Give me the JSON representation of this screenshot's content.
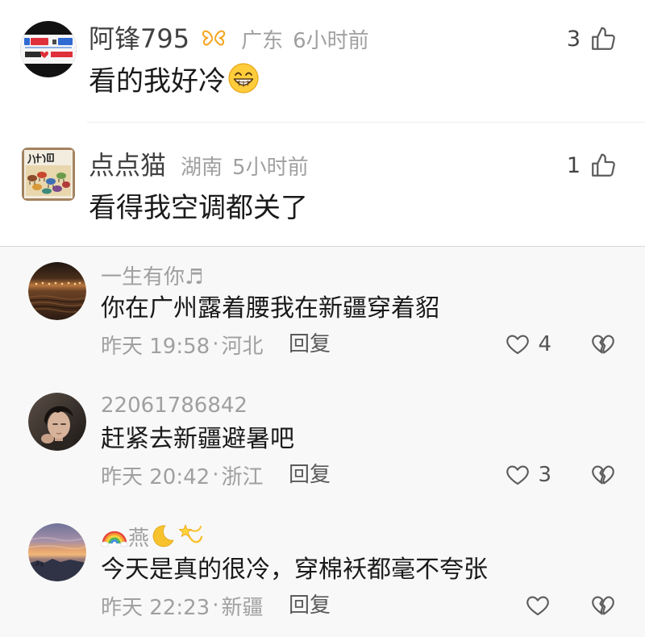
{
  "colors": {
    "text": "#1a1a1a",
    "username-top": "#414141",
    "muted": "#a0a0a0",
    "reply": "#5a5a5a",
    "icon": "#5c5c5c",
    "badge": "#f5a623",
    "section-bg": "#f8f8f8"
  },
  "icons": {
    "like": "thumbs-up-icon",
    "heart": "heart-outline-icon",
    "dislike": "broken-heart-icon"
  },
  "meta_separator": "·",
  "reply_label": "回复",
  "top_comments": [
    {
      "username": "阿锋795",
      "badge_icon": "butterfly-badge-icon",
      "location": "广东",
      "time": "6小时前",
      "likes": "3",
      "text": "看的我好冷",
      "text_emoji": "beaming-face-emoji"
    },
    {
      "username": "点点猫",
      "location": "湖南",
      "time": "5小时前",
      "likes": "1",
      "text": "看得我空调都关了"
    }
  ],
  "bottom_comments": [
    {
      "username": "一生有你♬",
      "text": "你在广州露着腰我在新疆穿着貂",
      "time": "昨天 19:58",
      "location": "河北",
      "likes": "4"
    },
    {
      "username": "22061786842",
      "text": "赶紧去新疆避暑吧",
      "time": "昨天 20:42",
      "location": "浙江",
      "likes": "3"
    },
    {
      "username_emoji_before": [
        "rainbow-emoji"
      ],
      "username": "燕",
      "username_emoji_after": [
        "crescent-moon-emoji",
        "dizzy-emoji"
      ],
      "text": "今天是真的很冷，穿棉袄都毫不夸张",
      "time": "昨天 22:23",
      "location": "新疆"
    }
  ]
}
